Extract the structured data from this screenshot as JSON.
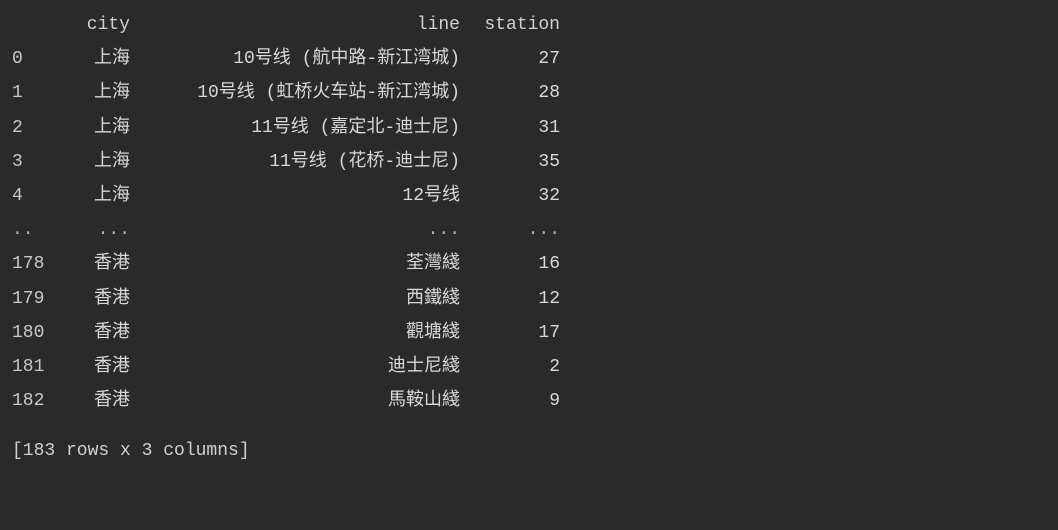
{
  "header": {
    "index": "",
    "city": "city",
    "line": "line",
    "station": "station"
  },
  "rows": [
    {
      "index": "0",
      "city": "上海",
      "line": "10号线 (航中路-新江湾城)",
      "station": "27"
    },
    {
      "index": "1",
      "city": "上海",
      "line": "10号线 (虹桥火车站-新江湾城)",
      "station": "28"
    },
    {
      "index": "2",
      "city": "上海",
      "line": "11号线 (嘉定北-迪士尼)",
      "station": "31"
    },
    {
      "index": "3",
      "city": "上海",
      "line": "11号线 (花桥-迪士尼)",
      "station": "35"
    },
    {
      "index": "4",
      "city": "上海",
      "line": "12号线",
      "station": "32"
    }
  ],
  "ellipsis": {
    "index": "..",
    "city": "...",
    "line": "...",
    "station": "..."
  },
  "rows_tail": [
    {
      "index": "178",
      "city": "香港",
      "line": "荃灣綫",
      "station": "16"
    },
    {
      "index": "179",
      "city": "香港",
      "line": "西鐵綫",
      "station": "12"
    },
    {
      "index": "180",
      "city": "香港",
      "line": "觀塘綫",
      "station": "17"
    },
    {
      "index": "181",
      "city": "香港",
      "line": "迪士尼綫",
      "station": "2"
    },
    {
      "index": "182",
      "city": "香港",
      "line": "馬鞍山綫",
      "station": "9"
    }
  ],
  "summary": "[183 rows x 3 columns]"
}
